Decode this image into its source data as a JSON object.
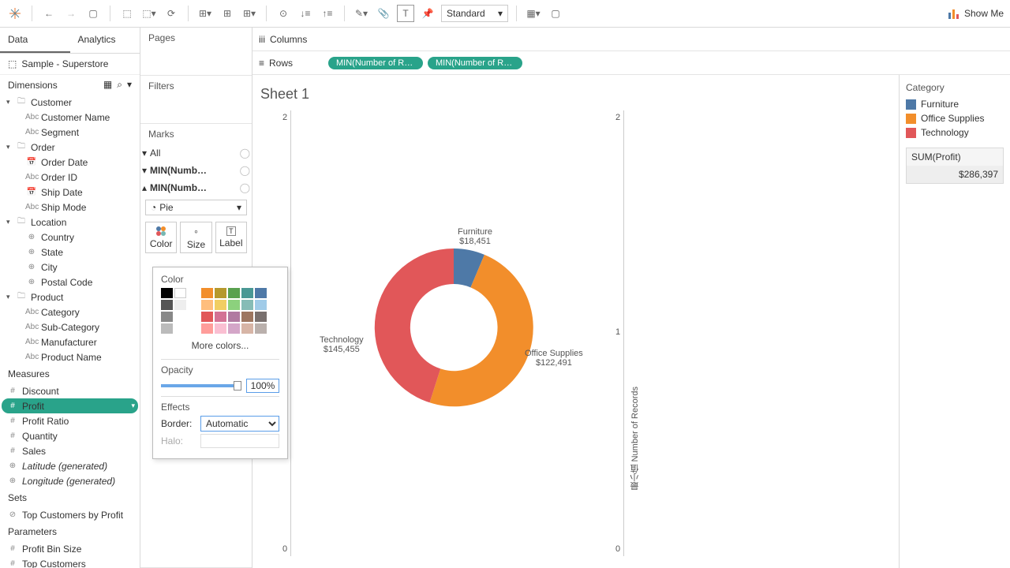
{
  "toolbar": {
    "fit": "Standard",
    "showme": "Show Me"
  },
  "pane": {
    "tabs": {
      "data": "Data",
      "analytics": "Analytics"
    },
    "source": "Sample - Superstore",
    "dimensions_label": "Dimensions",
    "measures_label": "Measures",
    "sets_label": "Sets",
    "parameters_label": "Parameters"
  },
  "dims": {
    "customer": "Customer",
    "customer_name": "Customer Name",
    "segment": "Segment",
    "order": "Order",
    "order_date": "Order Date",
    "order_id": "Order ID",
    "ship_date": "Ship Date",
    "ship_mode": "Ship Mode",
    "location": "Location",
    "country": "Country",
    "state": "State",
    "city": "City",
    "postal": "Postal Code",
    "product": "Product",
    "category": "Category",
    "subcat": "Sub-Category",
    "manufacturer": "Manufacturer",
    "prodname": "Product Name"
  },
  "meas": {
    "discount": "Discount",
    "profit": "Profit",
    "profit_ratio": "Profit Ratio",
    "quantity": "Quantity",
    "sales": "Sales",
    "lat": "Latitude (generated)",
    "lon": "Longitude (generated)"
  },
  "sets": {
    "top_customers": "Top Customers by Profit"
  },
  "params": {
    "bin": "Profit Bin Size",
    "top": "Top Customers"
  },
  "cards": {
    "pages": "Pages",
    "filters": "Filters",
    "marks": "Marks"
  },
  "marks": {
    "all": "All",
    "m1": "MIN(Numb…",
    "m2": "MIN(Numb…",
    "type": "Pie",
    "color": "Color",
    "size": "Size",
    "label": "Label"
  },
  "shelves": {
    "columns": "Columns",
    "rows": "Rows",
    "pill1": "MIN(Number of Recor..",
    "pill2": "MIN(Number of Recor.."
  },
  "viz": {
    "title": "Sheet 1",
    "axis_y": "最小值 Number of Records"
  },
  "legend": {
    "title": "Category",
    "items": [
      {
        "label": "Furniture",
        "color": "#4e79a7"
      },
      {
        "label": "Office Supplies",
        "color": "#f28e2b"
      },
      {
        "label": "Technology",
        "color": "#e15759"
      }
    ],
    "sum_label": "SUM(Profit)",
    "sum_value": "$286,397"
  },
  "popup": {
    "color": "Color",
    "more": "More colors...",
    "opacity": "Opacity",
    "op_val": "100%",
    "effects": "Effects",
    "border": "Border:",
    "border_val": "Automatic",
    "halo": "Halo:"
  },
  "chart_data": {
    "type": "pie",
    "title": "Sheet 1",
    "series": [
      {
        "name": "Furniture",
        "value": 18451,
        "label": "$18,451",
        "color": "#4e79a7"
      },
      {
        "name": "Office Supplies",
        "value": 122491,
        "label": "$122,491",
        "color": "#f28e2b"
      },
      {
        "name": "Technology",
        "value": 145455,
        "label": "$145,455",
        "color": "#e15759"
      }
    ],
    "total": 286397,
    "donut": true,
    "y_axis_ticks": [
      0,
      1,
      2
    ]
  }
}
